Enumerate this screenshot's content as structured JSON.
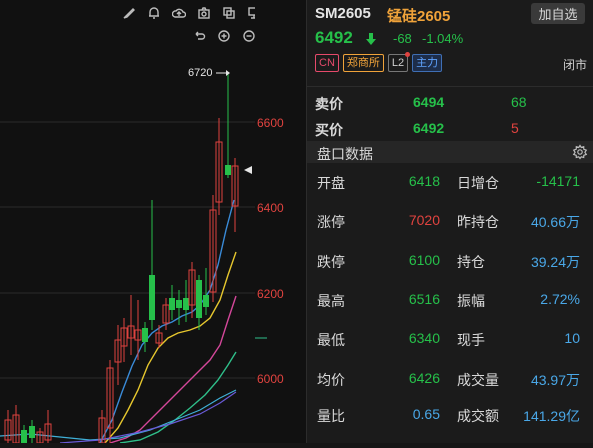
{
  "quote": {
    "code": "SM2605",
    "name": "锰硅2605",
    "add_favorite": "加自选",
    "price": "6492",
    "change": "-68",
    "change_pct": "-1.04%",
    "tags": [
      "CN",
      "郑商所",
      "L2",
      "主力"
    ],
    "market_status": "闭市"
  },
  "order_book": {
    "ask": {
      "label": "卖价",
      "price": "6494",
      "volume": "68"
    },
    "bid": {
      "label": "买价",
      "price": "6492",
      "volume": "5"
    }
  },
  "stats_section_title": "盘口数据",
  "stats": [
    {
      "label": "开盘",
      "value": "6418",
      "color": "#26c04a",
      "label2": "日增仓",
      "value2": "-14171",
      "color2": "#26c04a"
    },
    {
      "label": "涨停",
      "value": "7020",
      "color": "#e0433f",
      "label2": "昨持仓",
      "value2": "40.66万",
      "color2": "#4aa8e8"
    },
    {
      "label": "跌停",
      "value": "6100",
      "color": "#26c04a",
      "label2": "持仓",
      "value2": "39.24万",
      "color2": "#4aa8e8"
    },
    {
      "label": "最高",
      "value": "6516",
      "color": "#26c04a",
      "label2": "振幅",
      "value2": "2.72%",
      "color2": "#4aa8e8"
    },
    {
      "label": "最低",
      "value": "6340",
      "color": "#26c04a",
      "label2": "现手",
      "value2": "10",
      "color2": "#4aa8e8"
    },
    {
      "label": "均价",
      "value": "6426",
      "color": "#26c04a",
      "label2": "成交量",
      "value2": "43.97万",
      "color2": "#4aa8e8"
    },
    {
      "label": "量比",
      "value": "0.65",
      "color": "#4aa8e8",
      "label2": "成交额",
      "value2": "141.29亿",
      "color2": "#4aa8e8"
    }
  ],
  "chart": {
    "max_marker": "6720",
    "axis_labels": [
      "6600",
      "6400",
      "6200",
      "6000"
    ]
  },
  "toolbar_icons": [
    "brush-icon",
    "bell-icon",
    "cloud-icon",
    "camera-icon",
    "copy-icon",
    "monitor-icon",
    "expand-icon",
    "undo-icon",
    "zoom-in-icon",
    "zoom-out-icon",
    "settings-icon"
  ],
  "colors": {
    "up": "#e0433f",
    "down": "#26c04a",
    "info": "#4aa8e8",
    "name": "#f0a33a"
  }
}
